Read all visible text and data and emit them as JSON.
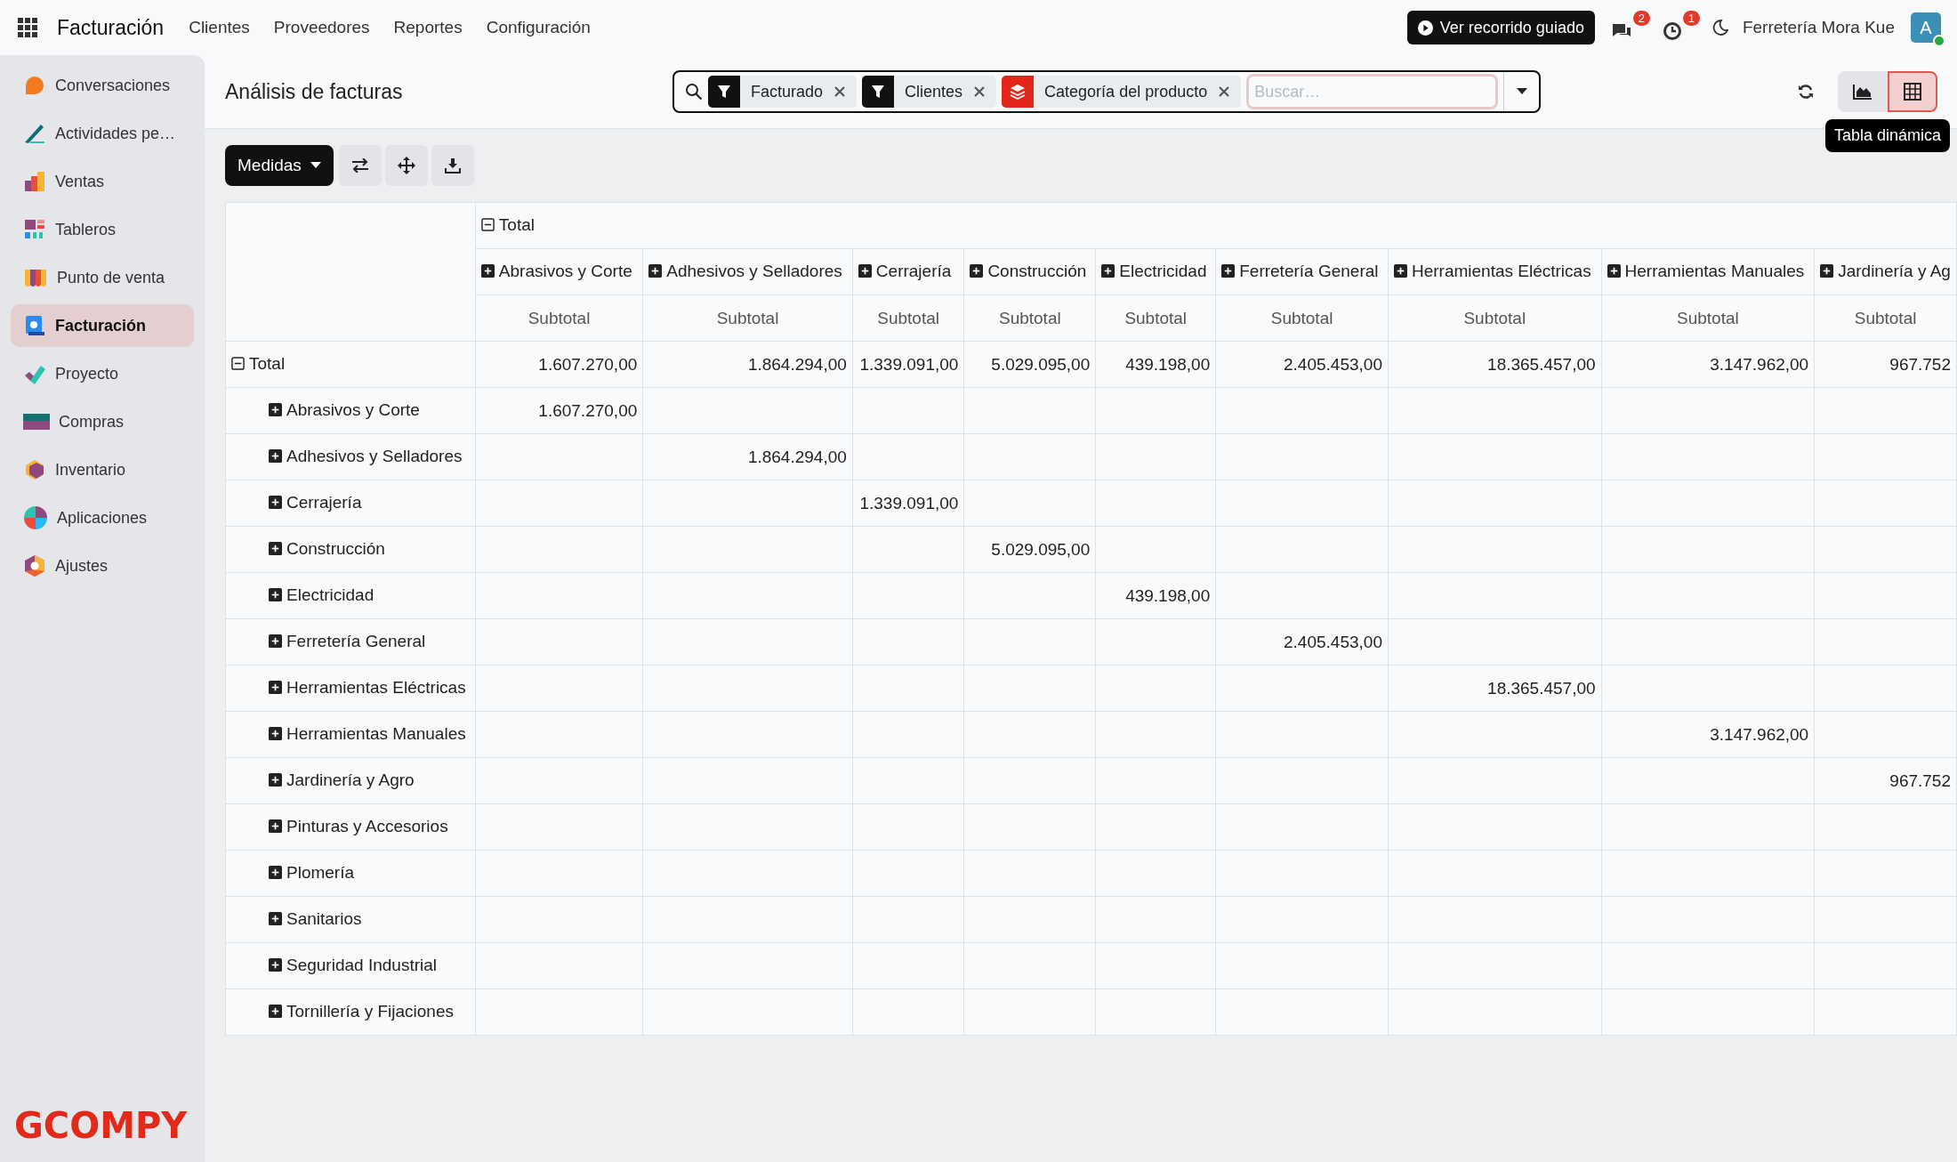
{
  "topbar": {
    "brand": "Facturación",
    "menu": [
      "Clientes",
      "Proveedores",
      "Reportes",
      "Configuración"
    ],
    "tour_button": "Ver recorrido guiado",
    "messages_badge": "2",
    "activities_badge": "1",
    "company": "Ferretería Mora Kue",
    "avatar": {
      "initial": "A",
      "online": true
    }
  },
  "sidebar": {
    "items": [
      {
        "label": "Conversaciones",
        "selected": false
      },
      {
        "label": "Actividades pe…",
        "selected": false
      },
      {
        "label": "Ventas",
        "selected": false
      },
      {
        "label": "Tableros",
        "selected": false
      },
      {
        "label": "Punto de venta",
        "selected": false
      },
      {
        "label": "Facturación",
        "selected": true
      },
      {
        "label": "Proyecto",
        "selected": false
      },
      {
        "label": "Compras",
        "selected": false
      },
      {
        "label": "Inventario",
        "selected": false
      },
      {
        "label": "Aplicaciones",
        "selected": false
      },
      {
        "label": "Ajustes",
        "selected": false
      }
    ],
    "brand_mark": "GCOMPY"
  },
  "control_panel": {
    "title": "Análisis de facturas",
    "facets": [
      {
        "kind": "filter",
        "label": "Facturado"
      },
      {
        "kind": "filter",
        "label": "Clientes"
      },
      {
        "kind": "group",
        "label": "Categoría del producto"
      }
    ],
    "search_placeholder": "Buscar…",
    "views": [
      {
        "kind": "graph",
        "selected": false
      },
      {
        "kind": "pivot",
        "selected": true
      }
    ],
    "tooltip": "Tabla dinámica"
  },
  "toolbar": {
    "measures_button": "Medidas"
  },
  "pivot": {
    "column_total": {
      "label": "Total",
      "expanded": true
    },
    "columns": [
      {
        "label": "Abrasivos y Corte",
        "expanded": false,
        "measure": "Subtotal"
      },
      {
        "label": "Adhesivos y Selladores",
        "expanded": false,
        "measure": "Subtotal"
      },
      {
        "label": "Cerrajería",
        "expanded": false,
        "measure": "Subtotal"
      },
      {
        "label": "Construcción",
        "expanded": false,
        "measure": "Subtotal"
      },
      {
        "label": "Electricidad",
        "expanded": false,
        "measure": "Subtotal"
      },
      {
        "label": "Ferretería General",
        "expanded": false,
        "measure": "Subtotal"
      },
      {
        "label": "Herramientas Eléctricas",
        "expanded": false,
        "measure": "Subtotal"
      },
      {
        "label": "Herramientas Manuales",
        "expanded": false,
        "measure": "Subtotal"
      },
      {
        "label": "Jardinería y Ag",
        "expanded": false,
        "measure": "Subtotal"
      }
    ],
    "total_row": {
      "label": "Total",
      "expanded": true,
      "cells": [
        "1.607.270,00",
        "1.864.294,00",
        "1.339.091,00",
        "5.029.095,00",
        "439.198,00",
        "2.405.453,00",
        "18.365.457,00",
        "3.147.962,00",
        "967.752"
      ]
    },
    "rows": [
      {
        "label": "Abrasivos y Corte",
        "expanded": false,
        "cells": [
          "1.607.270,00",
          null,
          null,
          null,
          null,
          null,
          null,
          null,
          null
        ]
      },
      {
        "label": "Adhesivos y Selladores",
        "expanded": false,
        "cells": [
          null,
          "1.864.294,00",
          null,
          null,
          null,
          null,
          null,
          null,
          null
        ]
      },
      {
        "label": "Cerrajería",
        "expanded": false,
        "cells": [
          null,
          null,
          "1.339.091,00",
          null,
          null,
          null,
          null,
          null,
          null
        ]
      },
      {
        "label": "Construcción",
        "expanded": false,
        "cells": [
          null,
          null,
          null,
          "5.029.095,00",
          null,
          null,
          null,
          null,
          null
        ]
      },
      {
        "label": "Electricidad",
        "expanded": false,
        "cells": [
          null,
          null,
          null,
          null,
          "439.198,00",
          null,
          null,
          null,
          null
        ]
      },
      {
        "label": "Ferretería General",
        "expanded": false,
        "cells": [
          null,
          null,
          null,
          null,
          null,
          "2.405.453,00",
          null,
          null,
          null
        ]
      },
      {
        "label": "Herramientas Eléctricas",
        "expanded": false,
        "cells": [
          null,
          null,
          null,
          null,
          null,
          null,
          "18.365.457,00",
          null,
          null
        ]
      },
      {
        "label": "Herramientas Manuales",
        "expanded": false,
        "cells": [
          null,
          null,
          null,
          null,
          null,
          null,
          null,
          "3.147.962,00",
          null
        ]
      },
      {
        "label": "Jardinería y Agro",
        "expanded": false,
        "cells": [
          null,
          null,
          null,
          null,
          null,
          null,
          null,
          null,
          "967.752"
        ]
      },
      {
        "label": "Pinturas y Accesorios",
        "expanded": false,
        "cells": [
          null,
          null,
          null,
          null,
          null,
          null,
          null,
          null,
          null
        ]
      },
      {
        "label": "Plomería",
        "expanded": false,
        "cells": [
          null,
          null,
          null,
          null,
          null,
          null,
          null,
          null,
          null
        ]
      },
      {
        "label": "Sanitarios",
        "expanded": false,
        "cells": [
          null,
          null,
          null,
          null,
          null,
          null,
          null,
          null,
          null
        ]
      },
      {
        "label": "Seguridad Industrial",
        "expanded": false,
        "cells": [
          null,
          null,
          null,
          null,
          null,
          null,
          null,
          null,
          null
        ]
      },
      {
        "label": "Tornillería y Fijaciones",
        "expanded": false,
        "cells": [
          null,
          null,
          null,
          null,
          null,
          null,
          null,
          null,
          null
        ]
      }
    ]
  }
}
